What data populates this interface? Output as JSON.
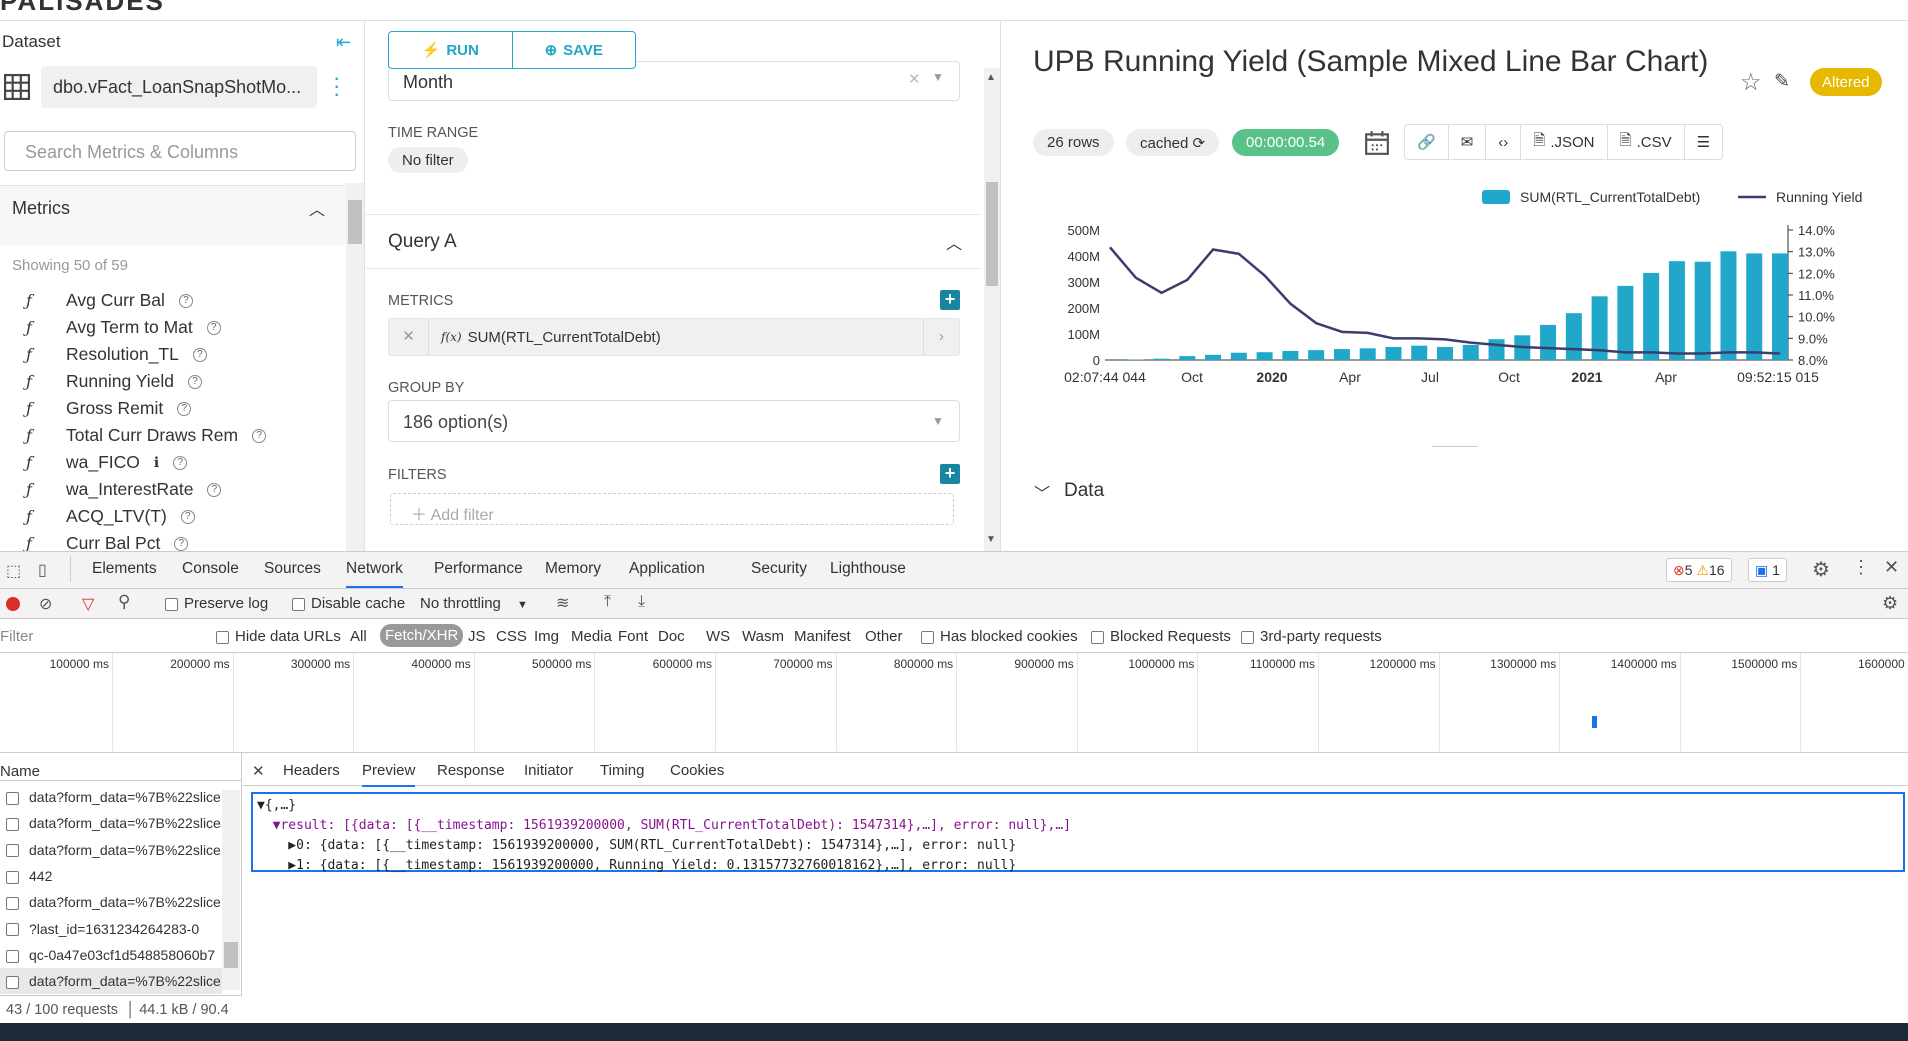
{
  "brand": "PALISADES",
  "left": {
    "dataset_label": "Dataset",
    "dataset_name": "dbo.vFact_LoanSnapShotMo...",
    "search_placeholder": "Search Metrics & Columns",
    "metrics_label": "Metrics",
    "showing": "Showing 50 of 59",
    "metrics": [
      "Avg Curr Bal",
      "Avg Term to Mat",
      "Resolution_TL",
      "Running Yield",
      "Gross Remit",
      "Total Curr Draws Rem",
      "wa_FICO",
      "wa_InterestRate",
      "ACQ_LTV(T)",
      "Curr Bal Pct"
    ]
  },
  "mid": {
    "run_label": "RUN",
    "save_label": "SAVE",
    "time_grain_value": "Month",
    "time_range_label": "TIME RANGE",
    "time_range_value": "No filter",
    "query_label": "Query A",
    "metrics_label": "METRICS",
    "metric_value": "SUM(RTL_CurrentTotalDebt)",
    "groupby_label": "GROUP BY",
    "groupby_value": "186 option(s)",
    "filters_label": "FILTERS",
    "add_filter": "Add filter"
  },
  "right": {
    "title": "UPB Running Yield (Sample Mixed Line Bar Chart)",
    "altered": "Altered",
    "rows": "26 rows",
    "cached": "cached",
    "duration": "00:00:00.54",
    "json": ".JSON",
    "csv": ".CSV",
    "data_label": "Data"
  },
  "chart_data": {
    "type": "bar",
    "series": [
      {
        "name": "SUM(RTL_CurrentTotalDebt)",
        "type": "bar",
        "color": "#20a7c9",
        "values": [
          0,
          2,
          5,
          15,
          20,
          28,
          30,
          35,
          38,
          42,
          45,
          50,
          55,
          50,
          58,
          80,
          95,
          135,
          180,
          245,
          285,
          335,
          380,
          378,
          418,
          410,
          410
        ]
      },
      {
        "name": "Running Yield",
        "type": "line",
        "color": "#3d3d6b",
        "values": [
          13.2,
          11.8,
          11.1,
          11.7,
          13.1,
          12.9,
          11.9,
          10.6,
          9.7,
          9.3,
          9.25,
          9.0,
          9.0,
          8.95,
          8.8,
          8.7,
          8.6,
          8.55,
          8.5,
          8.45,
          8.35,
          8.35,
          8.3,
          8.3,
          8.35,
          8.35,
          8.3
        ]
      }
    ],
    "yleft_ticks": [
      "500M",
      "400M",
      "300M",
      "200M",
      "100M",
      "0"
    ],
    "yright_ticks": [
      "14.0%",
      "13.0%",
      "12.0%",
      "11.0%",
      "10.0%",
      "9.0%",
      "8.0%"
    ],
    "x_ticks": [
      "02:07:44 044",
      "Oct",
      "2020",
      "Apr",
      "Jul",
      "Oct",
      "2021",
      "Apr",
      "09:52:15 015"
    ],
    "yleft_range": [
      0,
      500
    ],
    "yright_range": [
      8,
      14
    ]
  },
  "devtools": {
    "tabs": [
      "Elements",
      "Console",
      "Sources",
      "Network",
      "Performance",
      "Memory",
      "Application",
      "Security",
      "Lighthouse"
    ],
    "errors": "5",
    "warnings": "16",
    "info": "1",
    "preserve_log": "Preserve log",
    "disable_cache": "Disable cache",
    "throttling": "No throttling",
    "filter_placeholder": "Filter",
    "hide_data_urls": "Hide data URLs",
    "types": [
      "All",
      "Fetch/XHR",
      "JS",
      "CSS",
      "Img",
      "Media",
      "Font",
      "Doc",
      "WS",
      "Wasm",
      "Manifest",
      "Other"
    ],
    "has_blocked": "Has blocked cookies",
    "blocked_requests": "Blocked Requests",
    "third_party": "3rd-party requests",
    "ticks": [
      "100000 ms",
      "200000 ms",
      "300000 ms",
      "400000 ms",
      "500000 ms",
      "600000 ms",
      "700000 ms",
      "800000 ms",
      "900000 ms",
      "1000000 ms",
      "1100000 ms",
      "1200000 ms",
      "1300000 ms",
      "1400000 ms",
      "1500000 ms",
      "1600000 m"
    ],
    "name_header": "Name",
    "requests": [
      "data?form_data=%7B%22slice",
      "data?form_data=%7B%22slice",
      "data?form_data=%7B%22slice",
      "442",
      "data?form_data=%7B%22slice",
      "?last_id=1631234264283-0",
      "qc-0a47e03cf1d548858060b7",
      "data?form_data=%7B%22slice"
    ],
    "preview_tabs": [
      "Headers",
      "Preview",
      "Response",
      "Initiator",
      "Timing",
      "Cookies"
    ],
    "code": [
      "▼{,…}",
      "  ▼result: [{data: [{__timestamp: 1561939200000, SUM(RTL_CurrentTotalDebt): 1547314},…], error: null},…]",
      "    ▶0: {data: [{__timestamp: 1561939200000, SUM(RTL_CurrentTotalDebt): 1547314},…], error: null}",
      "    ▶1: {data: [{__timestamp: 1561939200000, Running Yield: 0.13157732760018162},…], error: null}"
    ],
    "status_requests": "43 / 100 requests",
    "status_size": "44.1 kB / 90.4"
  }
}
